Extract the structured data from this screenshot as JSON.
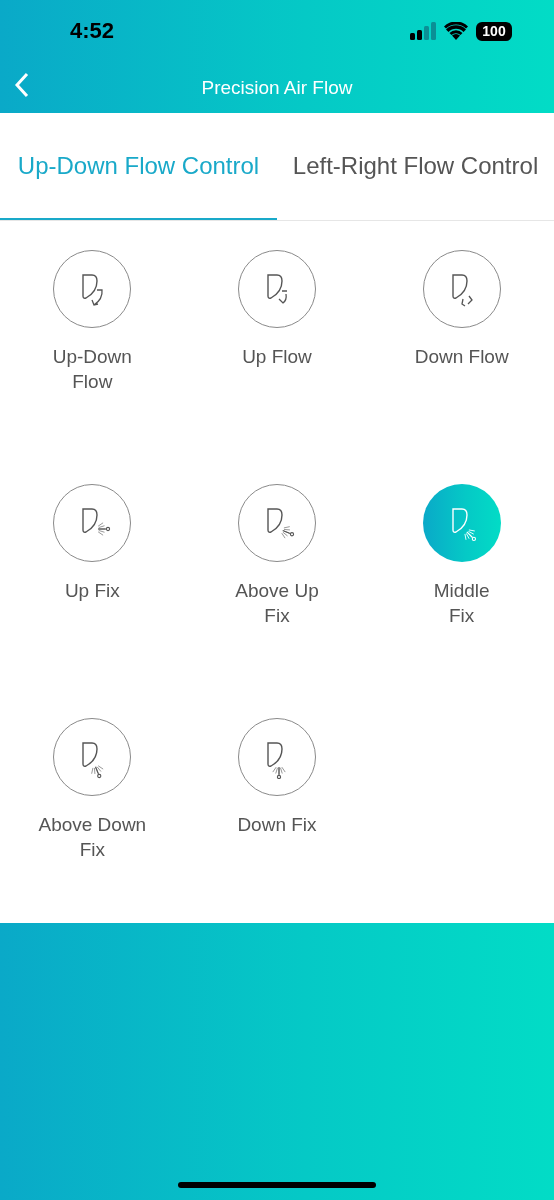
{
  "status_bar": {
    "time": "4:52",
    "battery": "100"
  },
  "nav": {
    "title": "Precision Air Flow"
  },
  "tabs": [
    {
      "label": "Up-Down Flow Control",
      "selected": true
    },
    {
      "label": "Left-Right Flow Control",
      "selected": false
    }
  ],
  "modes": [
    {
      "label": "Up-Down\nFlow",
      "kind": "swing-both",
      "selected": false
    },
    {
      "label": "Up Flow",
      "kind": "swing-up",
      "selected": false
    },
    {
      "label": "Down Flow",
      "kind": "swing-down",
      "selected": false
    },
    {
      "label": "Up Fix",
      "kind": "fix-up",
      "selected": false
    },
    {
      "label": "Above Up\nFix",
      "kind": "fix-above-up",
      "selected": false
    },
    {
      "label": "Middle\nFix",
      "kind": "fix-middle",
      "selected": true
    },
    {
      "label": "Above Down\nFix",
      "kind": "fix-above-down",
      "selected": false
    },
    {
      "label": "Down Fix",
      "kind": "fix-down",
      "selected": false
    }
  ]
}
